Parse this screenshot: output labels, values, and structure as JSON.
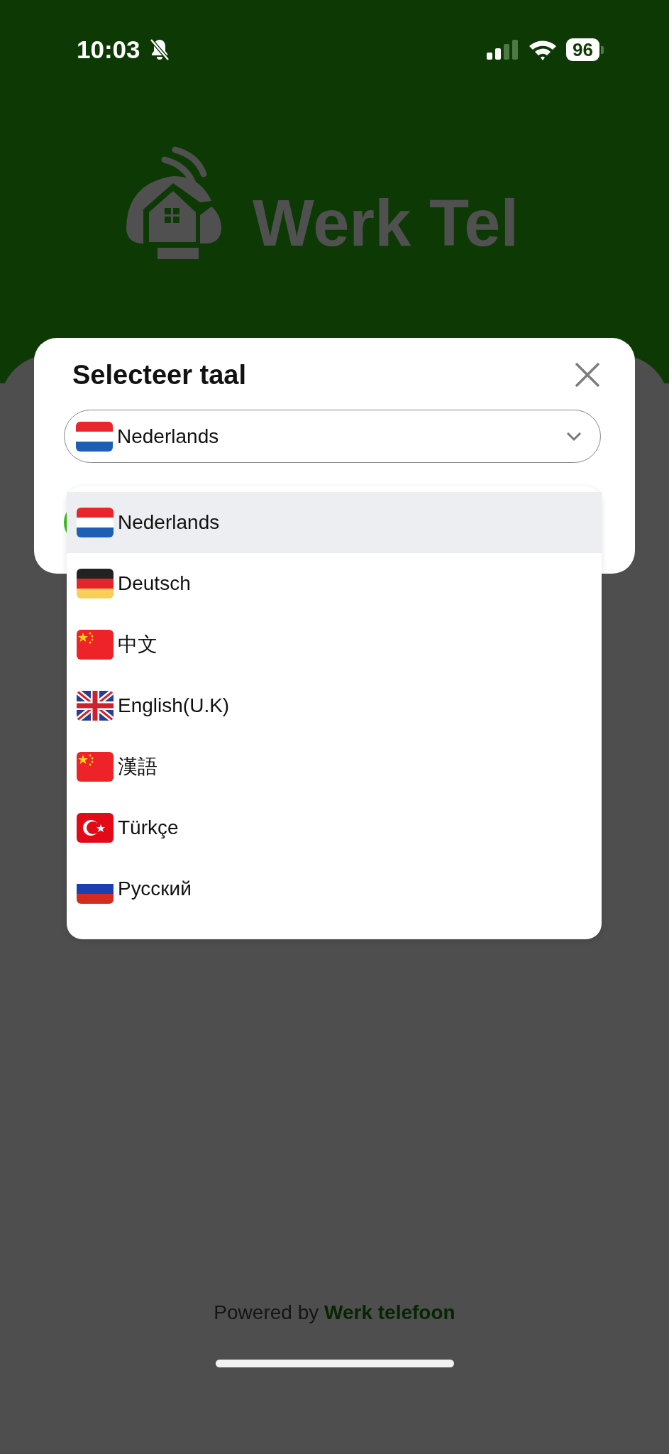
{
  "status_bar": {
    "time": "10:03",
    "battery": "96"
  },
  "logo": {
    "text": "Werk Tel"
  },
  "dialog": {
    "title": "Selecteer taal",
    "select": {
      "value": "Nederlands",
      "kind": "nl",
      "expanded": true
    },
    "options": [
      {
        "label": "Nederlands",
        "kind": "nl",
        "selected": true
      },
      {
        "label": "Deutsch",
        "kind": "de",
        "selected": false
      },
      {
        "label": "中文",
        "kind": "cn",
        "selected": false
      },
      {
        "label": "English(U.K)",
        "kind": "gb",
        "selected": false
      },
      {
        "label": "漢語",
        "kind": "cn",
        "selected": false
      },
      {
        "label": "Türkçe",
        "kind": "tr",
        "selected": false
      },
      {
        "label": "Русский",
        "kind": "ru",
        "selected": false
      }
    ]
  },
  "footer": {
    "text": "Powered by **Werk telefoon**"
  }
}
